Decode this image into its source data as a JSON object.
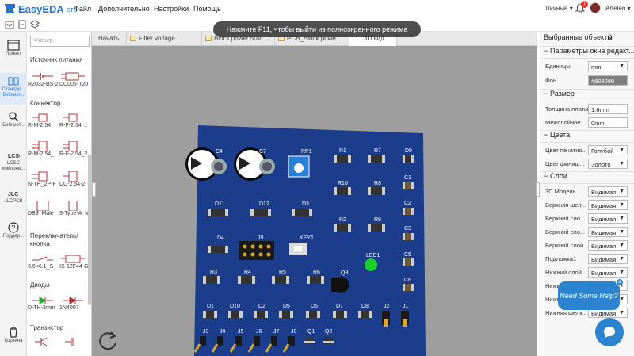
{
  "app": {
    "brand": "EasyEDA",
    "edition": "STD"
  },
  "menu": [
    "Файл",
    "Дополнительно",
    "Настройки",
    "Помощь"
  ],
  "topright": {
    "workspace": "Личные",
    "notif_count": "1",
    "user": "Artelen"
  },
  "toast": "Нажмите F11, чтобы выйти из полноэкранного режима",
  "rail": [
    {
      "label": "Проект",
      "icon": "project-icon"
    },
    {
      "label": "Стандар... библиот...",
      "icon": "library-icon"
    },
    {
      "label": "Библиот...",
      "icon": "search-library-icon"
    },
    {
      "label": "LCSC компоне...",
      "icon": "lcsc-icon"
    },
    {
      "label": "JLCPCB",
      "icon": "jlcpcb-icon"
    },
    {
      "label": "Поддер...",
      "icon": "help-icon"
    },
    {
      "label": "Корзина",
      "icon": "trash-icon"
    }
  ],
  "library": {
    "filter_placeholder": "Фильтр",
    "categories": [
      "Источник питания",
      "Коннектор",
      "Переключатель/ кнопка",
      "Диоды",
      "Транзистор"
    ],
    "items": [
      [
        "R2032-BS-2",
        "DC005-T20"
      ],
      [
        "R-M-2.54_",
        "R-F-2.54_1"
      ],
      [
        "R-M-2.54_",
        "R-F-2.54_2"
      ],
      [
        "N-TH_2P-F",
        "DC-2.54-2"
      ],
      [
        "DB9_Male",
        "3-Type-A_M"
      ],
      [
        "3.6×6.1_S",
        "IS-12F44-G"
      ],
      [
        "D-TH-3mm",
        "1N4007"
      ]
    ]
  },
  "tabs": [
    "Начать",
    "Filter voltage",
    "Block power 50V ...",
    "PCB_Block powe...",
    "3D вид"
  ],
  "right": {
    "selected": {
      "label": "Выбранные объекты",
      "count": "0"
    },
    "window_section": "Параметры окна редакт...",
    "units": {
      "label": "Единицы",
      "value": "mm"
    },
    "bg": {
      "label": "Фон",
      "value": "#808080"
    },
    "size_section": "Размер",
    "board_thickness": {
      "label": "Толщина платы",
      "value": "1.6mm"
    },
    "interlayer": {
      "label": "Межслойное ...",
      "value": "0mm"
    },
    "colors_section": "Цвета",
    "pcb_color": {
      "label": "Цвет печатно...",
      "value": "Голубой"
    },
    "finish_color": {
      "label": "Цвет финиш...",
      "value": "Золото"
    },
    "layers_section": "Слои",
    "layers": [
      {
        "label": "3D Модель",
        "value": "Видимая"
      },
      {
        "label": "Верхняя шел...",
        "value": "Видимая"
      },
      {
        "label": "Верхний сло...",
        "value": "Видимая"
      },
      {
        "label": "Верхний сло...",
        "value": "Видимая"
      },
      {
        "label": "Верхний слой",
        "value": "Видимая"
      },
      {
        "label": "Подложка1",
        "value": "Видимая"
      },
      {
        "label": "Нижний слой",
        "value": "Видимая"
      },
      {
        "label": "Нижни...",
        "value": "Видимая"
      },
      {
        "label": "Нижни...",
        "value": "Видимая"
      },
      {
        "label": "Нижняя шелк...",
        "value": "Видимая"
      }
    ]
  },
  "chat": {
    "text": "Need Some Help?"
  },
  "board": {
    "pcb_color": "#1b3d8c",
    "labels": {
      "C4": "C4",
      "C7": "C7",
      "RP1": "RP1",
      "R1": "R1",
      "R7": "R7",
      "D9": "D9",
      "R10": "R10",
      "R8": "R8",
      "C1": "C1",
      "C2": "C2",
      "D11": "D11",
      "D12": "D12",
      "D3": "D3",
      "R2": "R2",
      "R9": "R9",
      "C3": "C3",
      "D4": "D4",
      "J9": "J9",
      "KEY1": "KEY1",
      "LED1": "LED1",
      "C5": "C5",
      "R3": "R3",
      "R4": "R4",
      "R5": "R5",
      "R6": "R6",
      "Q3": "Q3",
      "C6": "C6",
      "D1": "D1",
      "D10": "D10",
      "D2": "D2",
      "D5": "D5",
      "D6": "D6",
      "D7": "D7",
      "D8": "D8",
      "J2": "J2",
      "J1": "J1",
      "J3": "J3",
      "J4": "J4",
      "J5": "J5",
      "J6": "J6",
      "J7": "J7",
      "J8": "J8",
      "Q1": "Q1",
      "Q2": "Q2"
    }
  }
}
